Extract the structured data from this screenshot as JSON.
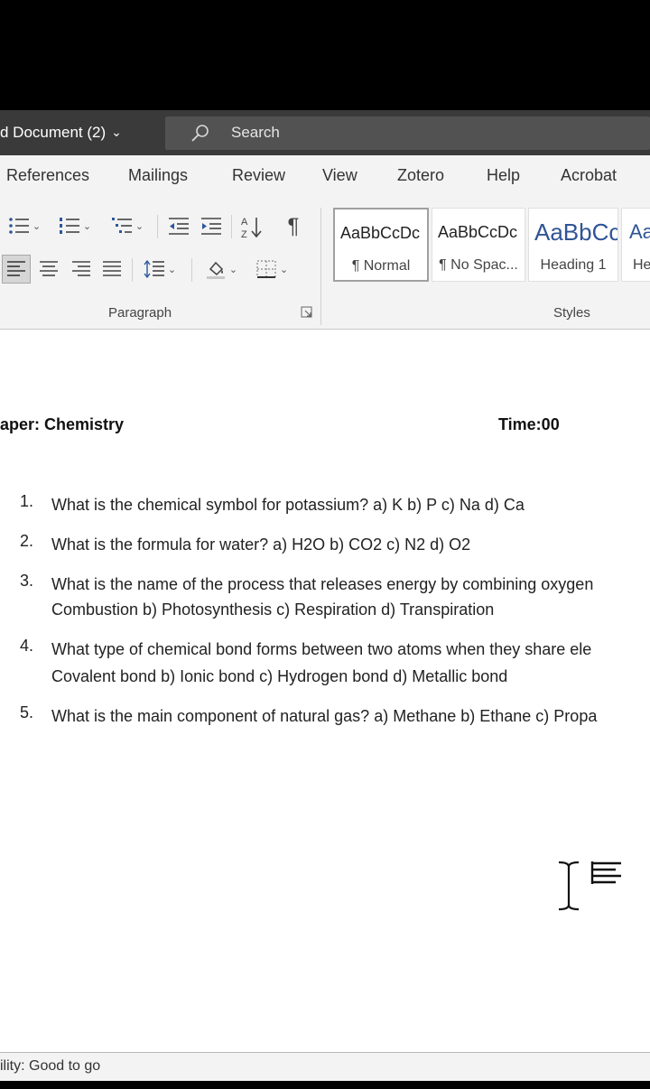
{
  "window": {
    "doc_title": "d Document (2)",
    "search_placeholder": "Search"
  },
  "tabs": [
    "References",
    "Mailings",
    "Review",
    "View",
    "Zotero",
    "Help",
    "Acrobat"
  ],
  "ribbon": {
    "paragraph_group_label": "Paragraph",
    "styles_group_label": "Styles",
    "styles": [
      {
        "sample": "AaBbCcDc",
        "name": "¶ Normal"
      },
      {
        "sample": "AaBbCcDc",
        "name": "¶ No Spac..."
      },
      {
        "sample": "AaBbCc",
        "name": "Heading 1"
      },
      {
        "sample": "Aa",
        "name": "He"
      }
    ],
    "sort_icon_text": "A↓Z",
    "pilcrow": "¶"
  },
  "document": {
    "paper_label": "aper: Chemistry",
    "time_label": "Time:00",
    "questions": [
      {
        "num": "1.",
        "lines": [
          "What is the chemical symbol for potassium? a) K b) P c) Na d) Ca"
        ]
      },
      {
        "num": "2.",
        "lines": [
          "What is the formula for water? a) H2O b) CO2 c) N2 d) O2"
        ]
      },
      {
        "num": "3.",
        "lines": [
          "What is the name of the process that releases energy by combining oxygen",
          "Combustion b) Photosynthesis c) Respiration d) Transpiration"
        ]
      },
      {
        "num": "4.",
        "lines": [
          "What type of chemical bond forms between two atoms when they share ele",
          "Covalent bond b) Ionic bond c) Hydrogen bond d) Metallic bond"
        ]
      },
      {
        "num": "5.",
        "lines": [
          "What is the main component of natural gas? a) Methane b) Ethane c) Propa"
        ]
      }
    ]
  },
  "status": {
    "accessibility": "ility: Good to go"
  }
}
